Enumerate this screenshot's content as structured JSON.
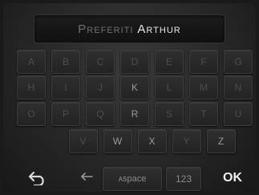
{
  "title": {
    "label": "Preferiti",
    "value": "Arthur"
  },
  "keyboard": {
    "rows": [
      [
        "A",
        "B",
        "C",
        "D",
        "E",
        "F",
        "G"
      ],
      [
        "H",
        "I",
        "J",
        "K",
        "L",
        "M",
        "N"
      ],
      [
        "O",
        "P",
        "Q",
        "R",
        "S",
        "T",
        "U"
      ],
      [
        "V",
        "W",
        "X",
        "Y",
        "Z"
      ]
    ],
    "bright_keys": [
      "W",
      "K",
      "R",
      "X",
      "Z"
    ]
  },
  "bottom": {
    "space_label": "ᴀspace",
    "numbers_label": "123",
    "ok_label": "OK"
  },
  "icons": {
    "back": "back-arrow-icon",
    "backspace": "backspace-icon"
  }
}
